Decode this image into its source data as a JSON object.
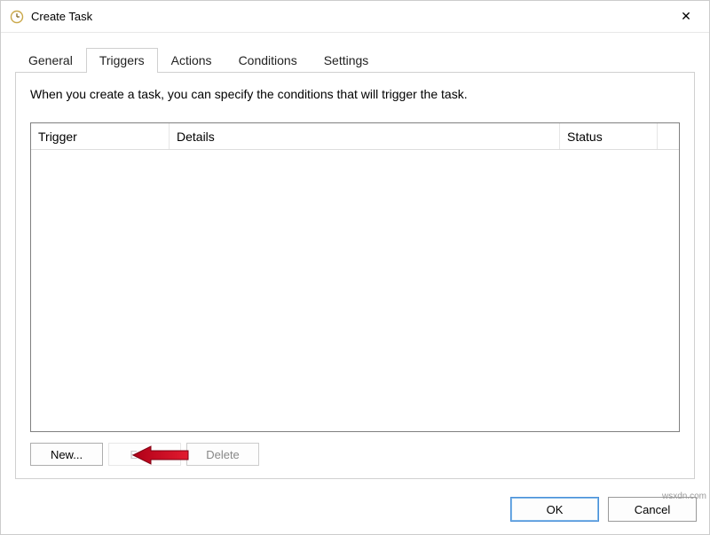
{
  "window": {
    "title": "Create Task",
    "close_glyph": "✕"
  },
  "tabs": {
    "general": "General",
    "triggers": "Triggers",
    "actions": "Actions",
    "conditions": "Conditions",
    "settings": "Settings"
  },
  "panel": {
    "description": "When you create a task, you can specify the conditions that will trigger the task."
  },
  "grid": {
    "col_trigger": "Trigger",
    "col_details": "Details",
    "col_status": "Status"
  },
  "buttons": {
    "new": "New...",
    "edit": "Edit...",
    "delete": "Delete"
  },
  "dialog": {
    "ok": "OK",
    "cancel": "Cancel"
  },
  "watermark": "wsxdn.com"
}
